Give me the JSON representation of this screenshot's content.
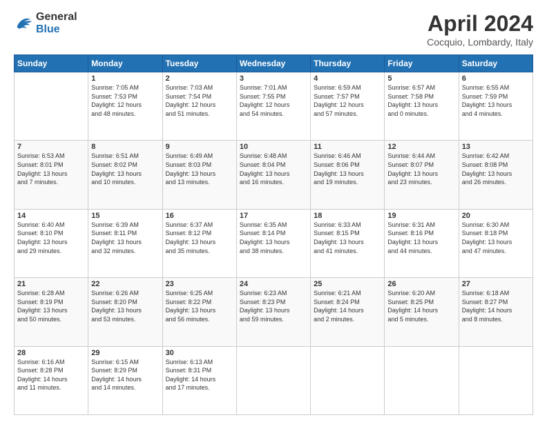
{
  "header": {
    "logo_line1": "General",
    "logo_line2": "Blue",
    "month_year": "April 2024",
    "location": "Cocquio, Lombardy, Italy"
  },
  "weekdays": [
    "Sunday",
    "Monday",
    "Tuesday",
    "Wednesday",
    "Thursday",
    "Friday",
    "Saturday"
  ],
  "weeks": [
    [
      {
        "day": "",
        "info": ""
      },
      {
        "day": "1",
        "info": "Sunrise: 7:05 AM\nSunset: 7:53 PM\nDaylight: 12 hours\nand 48 minutes."
      },
      {
        "day": "2",
        "info": "Sunrise: 7:03 AM\nSunset: 7:54 PM\nDaylight: 12 hours\nand 51 minutes."
      },
      {
        "day": "3",
        "info": "Sunrise: 7:01 AM\nSunset: 7:55 PM\nDaylight: 12 hours\nand 54 minutes."
      },
      {
        "day": "4",
        "info": "Sunrise: 6:59 AM\nSunset: 7:57 PM\nDaylight: 12 hours\nand 57 minutes."
      },
      {
        "day": "5",
        "info": "Sunrise: 6:57 AM\nSunset: 7:58 PM\nDaylight: 13 hours\nand 0 minutes."
      },
      {
        "day": "6",
        "info": "Sunrise: 6:55 AM\nSunset: 7:59 PM\nDaylight: 13 hours\nand 4 minutes."
      }
    ],
    [
      {
        "day": "7",
        "info": "Sunrise: 6:53 AM\nSunset: 8:01 PM\nDaylight: 13 hours\nand 7 minutes."
      },
      {
        "day": "8",
        "info": "Sunrise: 6:51 AM\nSunset: 8:02 PM\nDaylight: 13 hours\nand 10 minutes."
      },
      {
        "day": "9",
        "info": "Sunrise: 6:49 AM\nSunset: 8:03 PM\nDaylight: 13 hours\nand 13 minutes."
      },
      {
        "day": "10",
        "info": "Sunrise: 6:48 AM\nSunset: 8:04 PM\nDaylight: 13 hours\nand 16 minutes."
      },
      {
        "day": "11",
        "info": "Sunrise: 6:46 AM\nSunset: 8:06 PM\nDaylight: 13 hours\nand 19 minutes."
      },
      {
        "day": "12",
        "info": "Sunrise: 6:44 AM\nSunset: 8:07 PM\nDaylight: 13 hours\nand 23 minutes."
      },
      {
        "day": "13",
        "info": "Sunrise: 6:42 AM\nSunset: 8:08 PM\nDaylight: 13 hours\nand 26 minutes."
      }
    ],
    [
      {
        "day": "14",
        "info": "Sunrise: 6:40 AM\nSunset: 8:10 PM\nDaylight: 13 hours\nand 29 minutes."
      },
      {
        "day": "15",
        "info": "Sunrise: 6:39 AM\nSunset: 8:11 PM\nDaylight: 13 hours\nand 32 minutes."
      },
      {
        "day": "16",
        "info": "Sunrise: 6:37 AM\nSunset: 8:12 PM\nDaylight: 13 hours\nand 35 minutes."
      },
      {
        "day": "17",
        "info": "Sunrise: 6:35 AM\nSunset: 8:14 PM\nDaylight: 13 hours\nand 38 minutes."
      },
      {
        "day": "18",
        "info": "Sunrise: 6:33 AM\nSunset: 8:15 PM\nDaylight: 13 hours\nand 41 minutes."
      },
      {
        "day": "19",
        "info": "Sunrise: 6:31 AM\nSunset: 8:16 PM\nDaylight: 13 hours\nand 44 minutes."
      },
      {
        "day": "20",
        "info": "Sunrise: 6:30 AM\nSunset: 8:18 PM\nDaylight: 13 hours\nand 47 minutes."
      }
    ],
    [
      {
        "day": "21",
        "info": "Sunrise: 6:28 AM\nSunset: 8:19 PM\nDaylight: 13 hours\nand 50 minutes."
      },
      {
        "day": "22",
        "info": "Sunrise: 6:26 AM\nSunset: 8:20 PM\nDaylight: 13 hours\nand 53 minutes."
      },
      {
        "day": "23",
        "info": "Sunrise: 6:25 AM\nSunset: 8:22 PM\nDaylight: 13 hours\nand 56 minutes."
      },
      {
        "day": "24",
        "info": "Sunrise: 6:23 AM\nSunset: 8:23 PM\nDaylight: 13 hours\nand 59 minutes."
      },
      {
        "day": "25",
        "info": "Sunrise: 6:21 AM\nSunset: 8:24 PM\nDaylight: 14 hours\nand 2 minutes."
      },
      {
        "day": "26",
        "info": "Sunrise: 6:20 AM\nSunset: 8:25 PM\nDaylight: 14 hours\nand 5 minutes."
      },
      {
        "day": "27",
        "info": "Sunrise: 6:18 AM\nSunset: 8:27 PM\nDaylight: 14 hours\nand 8 minutes."
      }
    ],
    [
      {
        "day": "28",
        "info": "Sunrise: 6:16 AM\nSunset: 8:28 PM\nDaylight: 14 hours\nand 11 minutes."
      },
      {
        "day": "29",
        "info": "Sunrise: 6:15 AM\nSunset: 8:29 PM\nDaylight: 14 hours\nand 14 minutes."
      },
      {
        "day": "30",
        "info": "Sunrise: 6:13 AM\nSunset: 8:31 PM\nDaylight: 14 hours\nand 17 minutes."
      },
      {
        "day": "",
        "info": ""
      },
      {
        "day": "",
        "info": ""
      },
      {
        "day": "",
        "info": ""
      },
      {
        "day": "",
        "info": ""
      }
    ]
  ]
}
